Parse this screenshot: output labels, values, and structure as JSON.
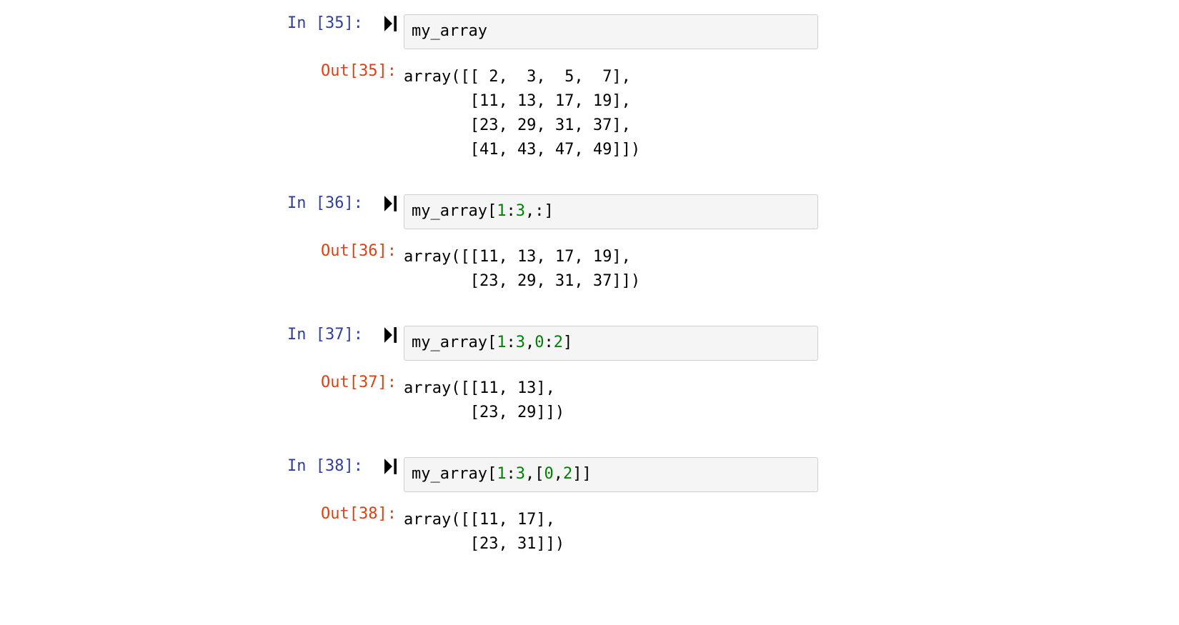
{
  "cells": [
    {
      "in_prompt": "In [35]:",
      "out_prompt": "Out[35]:",
      "input_tokens": [
        {
          "t": "my_array",
          "c": "code-text"
        }
      ],
      "output": "array([[ 2,  3,  5,  7],\n       [11, 13, 17, 19],\n       [23, 29, 31, 37],\n       [41, 43, 47, 49]])"
    },
    {
      "in_prompt": "In [36]:",
      "out_prompt": "Out[36]:",
      "input_tokens": [
        {
          "t": "my_array[",
          "c": "code-text"
        },
        {
          "t": "1",
          "c": "num"
        },
        {
          "t": ":",
          "c": "code-text"
        },
        {
          "t": "3",
          "c": "num"
        },
        {
          "t": ",:]",
          "c": "code-text"
        }
      ],
      "output": "array([[11, 13, 17, 19],\n       [23, 29, 31, 37]])"
    },
    {
      "in_prompt": "In [37]:",
      "out_prompt": "Out[37]:",
      "input_tokens": [
        {
          "t": "my_array[",
          "c": "code-text"
        },
        {
          "t": "1",
          "c": "num"
        },
        {
          "t": ":",
          "c": "code-text"
        },
        {
          "t": "3",
          "c": "num"
        },
        {
          "t": ",",
          "c": "code-text"
        },
        {
          "t": "0",
          "c": "num"
        },
        {
          "t": ":",
          "c": "code-text"
        },
        {
          "t": "2",
          "c": "num"
        },
        {
          "t": "]",
          "c": "code-text"
        }
      ],
      "output": "array([[11, 13],\n       [23, 29]])"
    },
    {
      "in_prompt": "In [38]:",
      "out_prompt": "Out[38]:",
      "input_tokens": [
        {
          "t": "my_array[",
          "c": "code-text"
        },
        {
          "t": "1",
          "c": "num"
        },
        {
          "t": ":",
          "c": "code-text"
        },
        {
          "t": "3",
          "c": "num"
        },
        {
          "t": ",[",
          "c": "code-text"
        },
        {
          "t": "0",
          "c": "num"
        },
        {
          "t": ",",
          "c": "code-text"
        },
        {
          "t": "2",
          "c": "num"
        },
        {
          "t": "]]",
          "c": "code-text"
        }
      ],
      "output": "array([[11, 17],\n       [23, 31]])"
    }
  ]
}
